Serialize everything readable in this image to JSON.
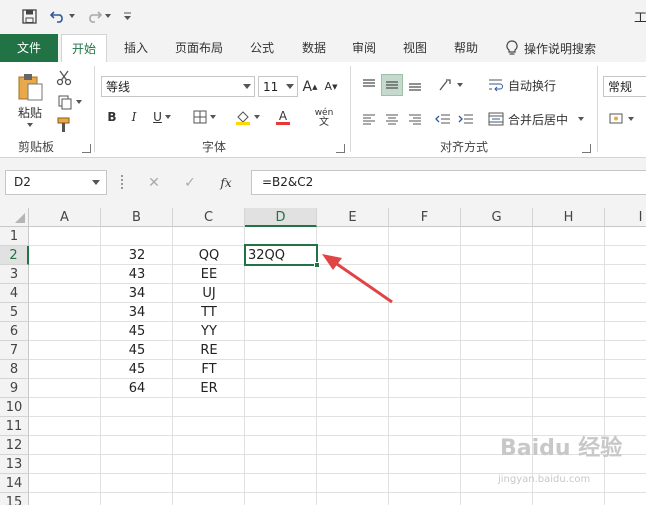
{
  "title_bar": {
    "title": "工"
  },
  "tabs": [
    "文件",
    "开始",
    "插入",
    "页面布局",
    "公式",
    "数据",
    "审阅",
    "视图",
    "帮助"
  ],
  "tell_me": "操作说明搜索",
  "ribbon": {
    "clipboard": {
      "paste": "粘贴",
      "label": "剪贴板"
    },
    "font": {
      "name": "等线",
      "size": "11",
      "bold": "B",
      "italic": "I",
      "underline": "U",
      "grow": "A",
      "shrink": "A",
      "color_letter": "A",
      "phonetic": "wén",
      "label": "字体"
    },
    "alignment": {
      "wrap_text": "自动换行",
      "merge_center": "合并后居中",
      "label": "对齐方式"
    },
    "number": {
      "format": "常规"
    }
  },
  "formula_bar": {
    "name_box": "D2",
    "fx": "fx",
    "formula": "=B2&C2"
  },
  "columns": [
    "A",
    "B",
    "C",
    "D",
    "E",
    "F",
    "G",
    "H",
    "I"
  ],
  "rows": [
    "1",
    "2",
    "3",
    "4",
    "5",
    "6",
    "7",
    "8",
    "9",
    "10",
    "11",
    "12",
    "13",
    "14",
    "15"
  ],
  "cells": {
    "B": [
      "",
      "32",
      "43",
      "34",
      "34",
      "45",
      "45",
      "45",
      "64"
    ],
    "C": [
      "",
      "QQ",
      "EE",
      "UJ",
      "TT",
      "YY",
      "RE",
      "FT",
      "ER"
    ],
    "D2": "32QQ"
  },
  "colors": {
    "accent": "#217346",
    "arrow": "#e04545"
  },
  "watermark": {
    "brand": "Baidu 经验",
    "url": "jingyan.baidu.com"
  }
}
